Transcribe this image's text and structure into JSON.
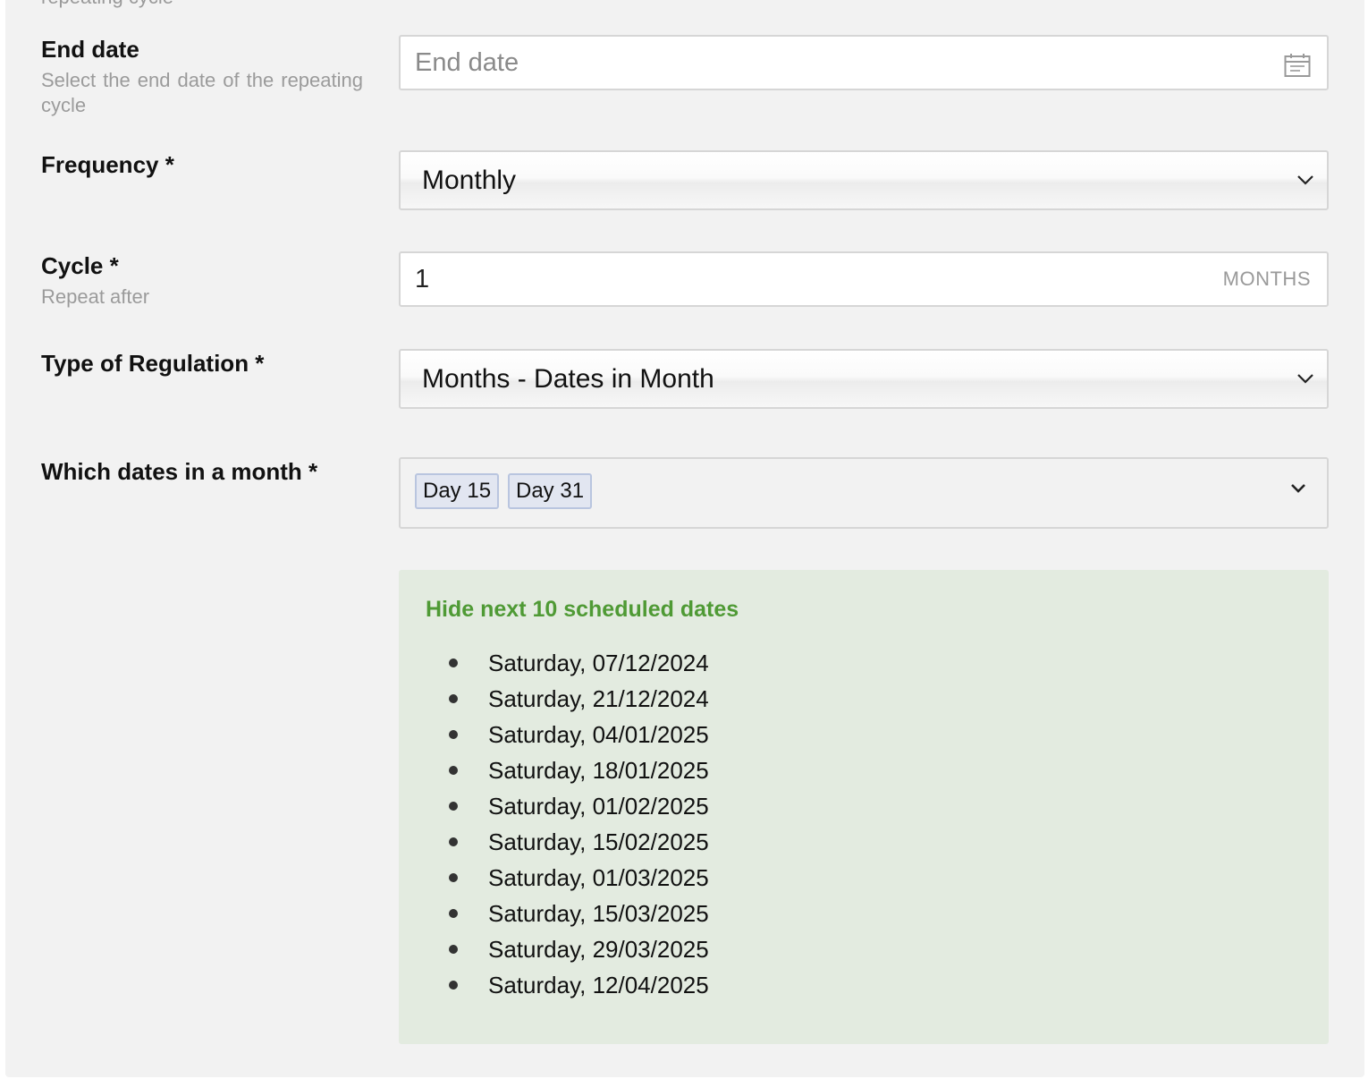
{
  "form": {
    "clipped_top_text": "repeating cycle",
    "end_date": {
      "label": "End date",
      "description": "Select the end date of the repeating cycle",
      "placeholder": "End date",
      "icon": "calendar-icon"
    },
    "frequency": {
      "label": "Frequency *",
      "selected": "Monthly",
      "icon": "chevron-down-icon"
    },
    "cycle": {
      "label": "Cycle *",
      "description": "Repeat after",
      "value": "1",
      "suffix": "MONTHS"
    },
    "regulation": {
      "label": "Type of Regulation *",
      "selected": "Months - Dates in Month",
      "icon": "chevron-down-icon"
    },
    "dates_in_month": {
      "label": "Which dates in a month *",
      "tags": [
        "Day 15",
        "Day 31"
      ],
      "icon": "chevron-down-icon"
    }
  },
  "schedule": {
    "toggle_label": "Hide next 10 scheduled dates",
    "dates": [
      "Saturday, 07/12/2024",
      "Saturday, 21/12/2024",
      "Saturday, 04/01/2025",
      "Saturday, 18/01/2025",
      "Saturday, 01/02/2025",
      "Saturday, 15/02/2025",
      "Saturday, 01/03/2025",
      "Saturday, 15/03/2025",
      "Saturday, 29/03/2025",
      "Saturday, 12/04/2025"
    ]
  },
  "colors": {
    "panel_bg": "#f2f2f2",
    "schedule_bg": "#e3ebe0",
    "link_green": "#4f9a35",
    "tag_bg": "#e2e6f1",
    "tag_border": "#b9c5df"
  }
}
